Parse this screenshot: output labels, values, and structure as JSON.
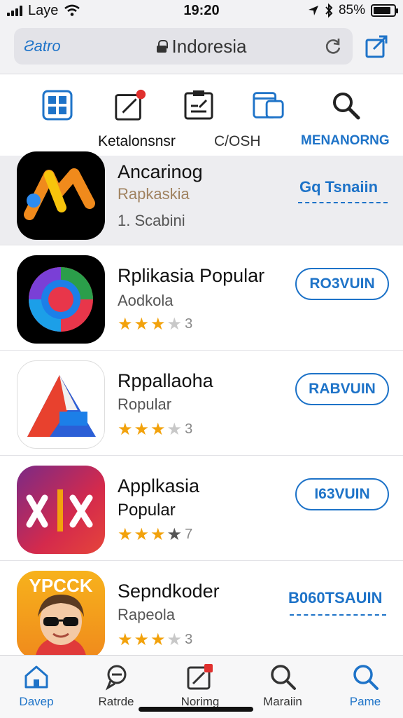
{
  "status_bar": {
    "carrier": "Laye",
    "time": "19:20",
    "battery": "85%",
    "battery_level": 0.85
  },
  "url_bar": {
    "back_label": "Ƨatro",
    "url": "Indoresia"
  },
  "category_tabs": [
    {
      "icon": "grid-icon",
      "label": ""
    },
    {
      "icon": "edit-badge-icon",
      "label": "Ketalonsnsr"
    },
    {
      "icon": "clipboard-icon",
      "label": ""
    },
    {
      "icon": "tablet-icon",
      "label": "C/OSH"
    },
    {
      "icon": "search-icon",
      "label": "MENANORNG"
    }
  ],
  "apps": [
    {
      "name": "Ancarinog",
      "subtitle": "Rapkaskia",
      "subtitle2": "1. Scabini",
      "button": "Gq Tsnaiin",
      "highlight": true
    },
    {
      "name": "Rplikasia Popular",
      "subtitle": "Aodkola",
      "rating": "3",
      "button": "RO3VUIN"
    },
    {
      "name": "Rppallaoha",
      "subtitle": "Ropular",
      "rating": "3",
      "button": "RABVUIN"
    },
    {
      "name": "Applkasia",
      "subtitle": "Popular",
      "rating": "7",
      "button": "I63VUIN"
    },
    {
      "name": "Sepndkoder",
      "subtitle": "Rapeola",
      "rating": "3",
      "button": "B060TSAUIN",
      "icon_text": "YPCCK"
    }
  ],
  "tab_bar": [
    {
      "label": "Davep",
      "icon": "home-icon",
      "active": true
    },
    {
      "label": "Ratrde",
      "icon": "chat-icon",
      "active": false
    },
    {
      "label": "Norimg",
      "icon": "edit-badge-icon",
      "active": false
    },
    {
      "label": "Maraiin",
      "icon": "search-icon",
      "active": false
    },
    {
      "label": "Pame",
      "icon": "search-icon",
      "active": true
    }
  ],
  "colors": {
    "accent": "#1e73c8",
    "star": "#f2a20c",
    "badge": "#e0302e"
  }
}
